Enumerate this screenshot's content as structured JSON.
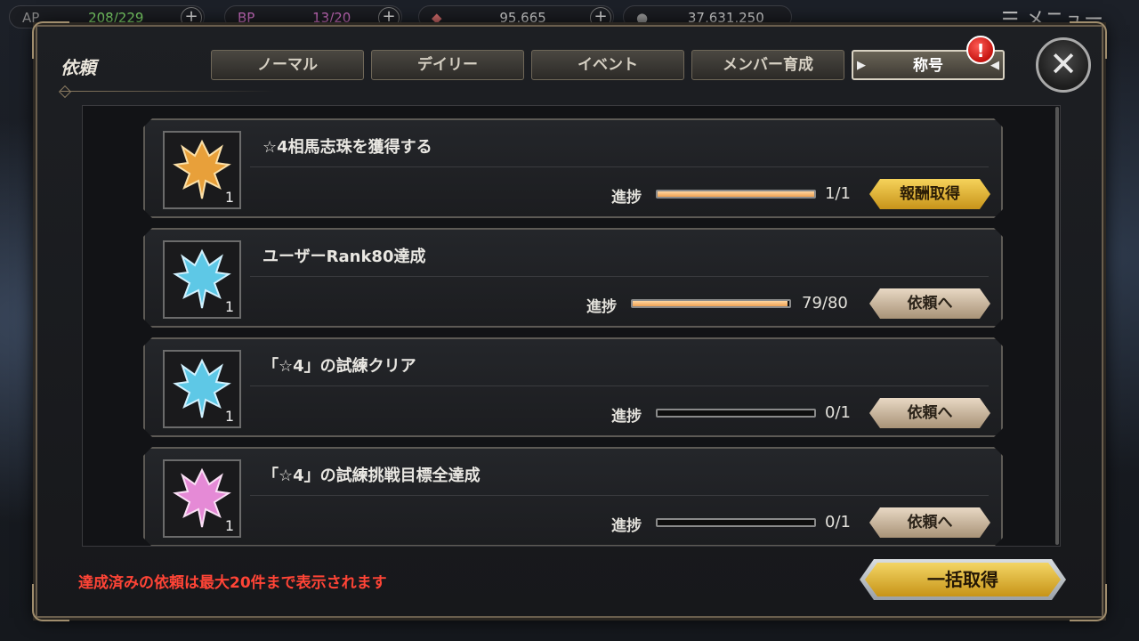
{
  "topbar": {
    "ap_label": "AP",
    "ap_value": "208/229",
    "bp_label": "BP",
    "bp_value": "13/20",
    "currency1_value": "95,665",
    "currency2_value": "37,631,250",
    "menu_label": "メニュー"
  },
  "modal": {
    "title": "依頼",
    "tabs": [
      {
        "label": "ノーマル"
      },
      {
        "label": "デイリー"
      },
      {
        "label": "イベント"
      },
      {
        "label": "メンバー育成"
      },
      {
        "label": "称号"
      }
    ],
    "alert_badge": "!",
    "close_glyph": "✕"
  },
  "quests": [
    {
      "title": "☆4相馬志珠を獲得する",
      "progress_label": "進捗",
      "progress_text": "1/1",
      "progress": 1.0,
      "button": "報酬取得",
      "icon_color": "#e8a03a",
      "icon_count": "1"
    },
    {
      "title": "ユーザーRank80達成",
      "progress_label": "進捗",
      "progress_text": "79/80",
      "progress": 0.9875,
      "button": "依頼へ",
      "icon_color": "#5ec8e6",
      "icon_count": "1"
    },
    {
      "title": "「☆4」の試練クリア",
      "progress_label": "進捗",
      "progress_text": "0/1",
      "progress": 0,
      "button": "依頼へ",
      "icon_color": "#5ec8e6",
      "icon_count": "1"
    },
    {
      "title": "「☆4」の試練挑戦目標全達成",
      "progress_label": "進捗",
      "progress_text": "0/1",
      "progress": 0,
      "button": "依頼へ",
      "icon_color": "#e58ad6",
      "icon_count": "1"
    }
  ],
  "footer": {
    "note": "達成済みの依頼は最大20件まで表示されます",
    "bulk_button": "一括取得"
  }
}
